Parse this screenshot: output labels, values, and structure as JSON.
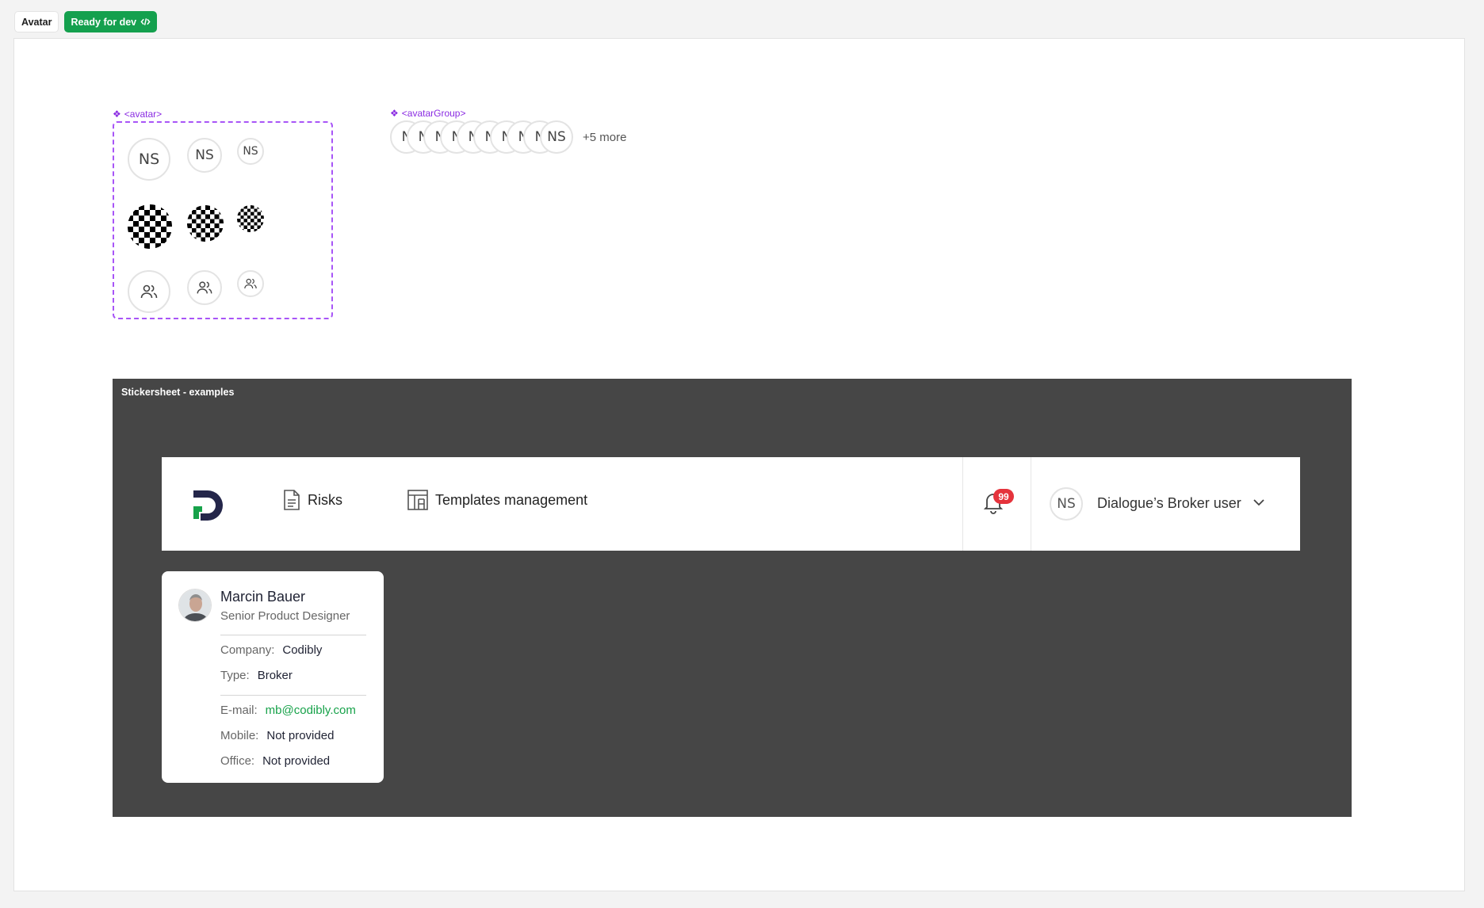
{
  "tags": {
    "name": "Avatar",
    "status": "Ready for dev"
  },
  "components": {
    "avatar_label": "<avatar>",
    "avatar_group_label": "<avatarGroup>",
    "avatar_initials": "NS",
    "group": {
      "items": [
        "N",
        "N",
        "N",
        "N",
        "N",
        "N",
        "N",
        "N",
        "N",
        "NS"
      ],
      "more": "+5 more"
    }
  },
  "stickersheet": {
    "title": "Stickersheet - examples",
    "header": {
      "nav": [
        {
          "label": "Risks",
          "icon": "document-icon"
        },
        {
          "label": "Templates management",
          "icon": "layout-icon"
        }
      ],
      "notifications_count": "99",
      "user_initials": "NS",
      "user_name": "Dialogue’s Broker user"
    },
    "profile_card": {
      "name": "Marcin Bauer",
      "role": "Senior Product Designer",
      "company_label": "Company:",
      "company": "Codibly",
      "type_label": "Type:",
      "type": "Broker",
      "email_label": "E-mail:",
      "email": "mb@codibly.com",
      "mobile_label": "Mobile:",
      "mobile": "Not provided",
      "office_label": "Office:",
      "office": "Not provided"
    }
  },
  "colors": {
    "accent": "#14a04e",
    "component": "#a855f7",
    "badge": "#e5333c",
    "dark_bg": "#464646"
  }
}
